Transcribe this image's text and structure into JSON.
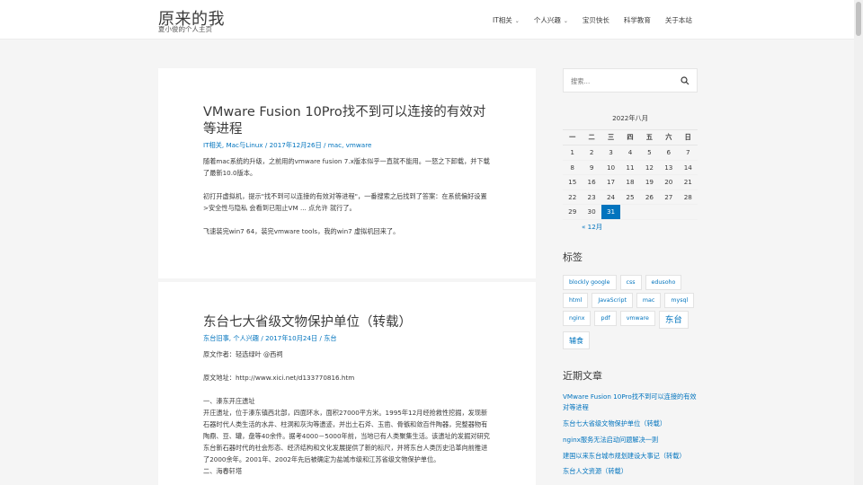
{
  "site": {
    "title": "原来的我",
    "description": "夏小俊的个人主页"
  },
  "nav": [
    {
      "label": "IT相关",
      "has_dropdown": true
    },
    {
      "label": "个人兴趣",
      "has_dropdown": true
    },
    {
      "label": "宝贝快长",
      "has_dropdown": false
    },
    {
      "label": "科学教育",
      "has_dropdown": false
    },
    {
      "label": "关于本站",
      "has_dropdown": false
    }
  ],
  "posts": [
    {
      "title": "VMware Fusion 10Pro找不到可以连接的有效对等进程",
      "meta": {
        "categories": "IT相关, Mac与Linux",
        "sep1": " / ",
        "date": "2017年12月26日",
        "sep2": " / ",
        "tags": "mac, vmware"
      },
      "paragraphs": [
        "随着mac系统的升级，之前用的vmware fusion 7.x版本似乎一直就不能用。一怒之下卸载，并下载了最新10.0版本。",
        "初打开虚拟机，提示\"找不到可以连接的有效对等进程\"，一番搜索之后找到了答案：在系统偏好设置>安全性与隐私 会看到已阻止VM ... 点允许 就行了。",
        "飞速装完win7 64，装完vmware tools，我的win7 虚拟机回来了。"
      ]
    },
    {
      "title": "东台七大省级文物保护单位（转载）",
      "meta": {
        "categories": "东台旧事, 个人兴趣",
        "sep1": " / ",
        "date": "2017年10月24日",
        "sep2": " / ",
        "tags": "东台"
      },
      "paragraphs": [
        "原文作者：轻选绿叶 @西祠",
        "原文地址：http://www.xici.net/d133770816.htm",
        "一、溱东开庄遗址",
        "开庄遗址，位于溱东镇西北部，四面环水，面积27000平方米。1995年12月经抢救性挖掘，发现新石器时代人类生活的水井、柱洞和灰沟等遗迹，并出土石斧、玉凿、骨镞和敛百件陶器，完整器物有陶鼎、豆、罐，盘等40余件。据考4000－5000年前，当地已有人类聚集生活。该遗址的发掘对研究东台新石器时代的社会形态、经济结构和文化发展提供了新的标尺，并将东台人类历史沿革向前推进了2000余年。2001年、2002年先后被确定为盐城市级和江苏省级文物保护单位。",
        "二、海春轩塔"
      ]
    }
  ],
  "sidebar": {
    "search_placeholder": "搜索...",
    "calendar": {
      "caption": "2022年八月",
      "weekdays": [
        "一",
        "二",
        "三",
        "四",
        "五",
        "六",
        "日"
      ],
      "weeks": [
        [
          "1",
          "2",
          "3",
          "4",
          "5",
          "6",
          "7"
        ],
        [
          "8",
          "9",
          "10",
          "11",
          "12",
          "13",
          "14"
        ],
        [
          "15",
          "16",
          "17",
          "18",
          "19",
          "20",
          "21"
        ],
        [
          "22",
          "23",
          "24",
          "25",
          "26",
          "27",
          "28"
        ],
        [
          "29",
          "30",
          "31",
          "",
          "",
          "",
          ""
        ]
      ],
      "today": "31",
      "prev_link": "« 12月"
    },
    "tags_title": "标签",
    "tags": [
      {
        "label": "blockly google",
        "size": "small"
      },
      {
        "label": "css",
        "size": "small"
      },
      {
        "label": "edusoho",
        "size": "small"
      },
      {
        "label": "html",
        "size": "small"
      },
      {
        "label": "JavaScript",
        "size": "small"
      },
      {
        "label": "mac",
        "size": "small"
      },
      {
        "label": "mysql",
        "size": "small"
      },
      {
        "label": "nginx",
        "size": "small"
      },
      {
        "label": "pdf",
        "size": "small"
      },
      {
        "label": "vmware",
        "size": "small"
      },
      {
        "label": "东台",
        "size": "big"
      },
      {
        "label": "辅食",
        "size": "mid"
      }
    ],
    "recent_title": "近期文章",
    "recent_posts": [
      "VMware Fusion 10Pro找不到可以连接的有效对等进程",
      "东台七大省级文物保护单位（转载）",
      "nginx服务无法启动问题解决一则",
      "建国以来东台城市规划建设大事记（转载）",
      "东台人文资源（转载）"
    ]
  },
  "colors": {
    "accent": "#0274be",
    "text": "#3a3a3a",
    "background": "#f5f5f5"
  }
}
